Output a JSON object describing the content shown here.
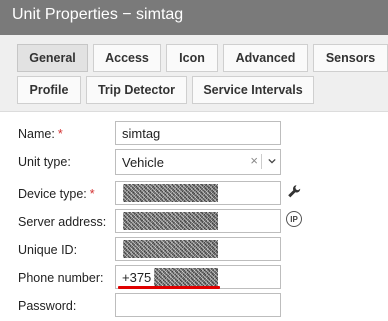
{
  "dialog": {
    "title": "Unit Properties − simtag"
  },
  "tabs": [
    {
      "label": "General",
      "active": true
    },
    {
      "label": "Access"
    },
    {
      "label": "Icon"
    },
    {
      "label": "Advanced"
    },
    {
      "label": "Sensors"
    },
    {
      "label": "Profile"
    },
    {
      "label": "Trip Detector"
    },
    {
      "label": "Service Intervals"
    }
  ],
  "form": {
    "name": {
      "label": "Name:",
      "required": "*",
      "value": "simtag"
    },
    "unit_type": {
      "label": "Unit type:",
      "value": "Vehicle",
      "clear": "×"
    },
    "device_type": {
      "label": "Device type:",
      "required": "*"
    },
    "server_address": {
      "label": "Server address:",
      "icon_text": "IP"
    },
    "unique_id": {
      "label": "Unique ID:"
    },
    "phone_number": {
      "label": "Phone number:",
      "value": "+375"
    },
    "password": {
      "label": "Password:",
      "value": ""
    }
  },
  "icons": {
    "wrench": "wrench-icon",
    "ip": "ip-icon",
    "arrow": "chevron-down-icon"
  },
  "colors": {
    "titlebar": "#7a7a7a",
    "required": "#d32f2f",
    "underline": "#e00000"
  }
}
